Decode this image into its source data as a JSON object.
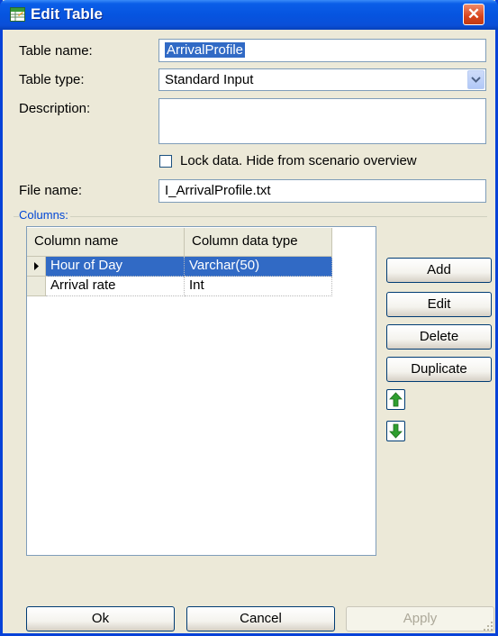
{
  "window": {
    "title": "Edit Table",
    "close_glyph": "✕",
    "icon": "table-edit-icon"
  },
  "form": {
    "table_name_label": "Table name:",
    "table_name_value": "ArrivalProfile",
    "table_type_label": "Table type:",
    "table_type_value": "Standard Input",
    "description_label": "Description:",
    "description_value": "",
    "lock_label": "Lock data. Hide from scenario overview",
    "lock_checked": false,
    "file_name_label": "File name:",
    "file_name_value": "I_ArrivalProfile.txt"
  },
  "columns": {
    "group_label": "Columns:",
    "headers": [
      "Column name",
      "Column data type"
    ],
    "rows": [
      {
        "name": "Hour of Day",
        "type": "Varchar(50)",
        "selected": true
      },
      {
        "name": "Arrival rate",
        "type": "Int",
        "selected": false
      }
    ],
    "buttons": {
      "add": "Add",
      "edit": "Edit",
      "delete": "Delete",
      "duplicate": "Duplicate",
      "move_up_icon": "arrow-up-icon",
      "move_down_icon": "arrow-down-icon"
    }
  },
  "footer": {
    "ok": "Ok",
    "cancel": "Cancel",
    "apply": "Apply",
    "apply_enabled": false
  },
  "colors": {
    "title_bar": "#0654e0",
    "selection": "#316ac5",
    "arrow_green": "#2f9e2f",
    "group_label": "#0046d5"
  }
}
